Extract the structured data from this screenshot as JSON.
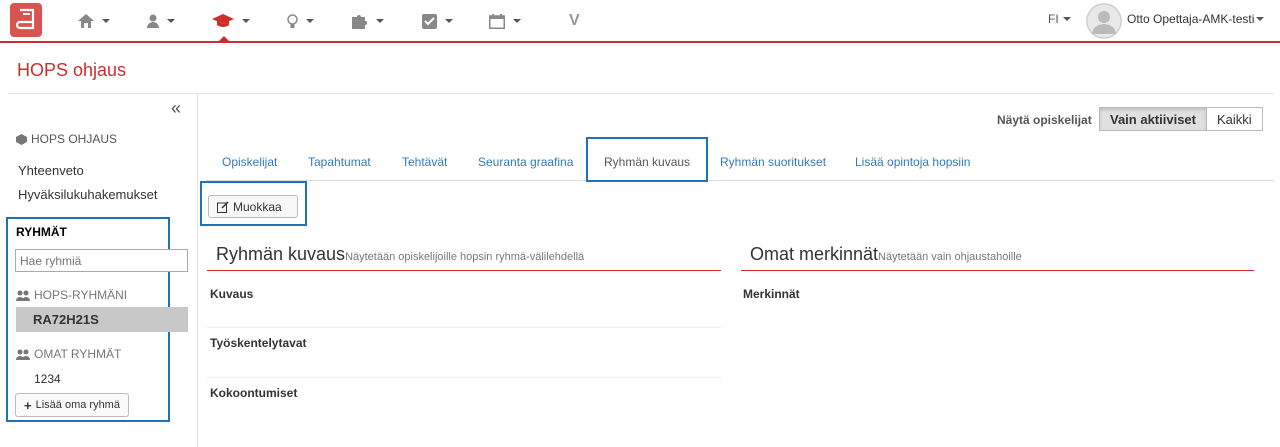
{
  "nav": {
    "items": [
      {
        "icon": "home-icon"
      },
      {
        "icon": "user-icon"
      },
      {
        "icon": "graduation-cap-icon",
        "active": true
      },
      {
        "icon": "lightbulb-icon"
      },
      {
        "icon": "puzzle-icon"
      },
      {
        "icon": "checkbox-icon"
      },
      {
        "icon": "calendar-icon"
      }
    ],
    "v_label": "V",
    "lang": "FI",
    "user_name": "Otto Opettaja-AMK-testi",
    "accent": "#c9302c"
  },
  "page": {
    "title": "HOPS ohjaus"
  },
  "sidebar": {
    "collapse_icon": "«",
    "heading": "HOPS OHJAUS",
    "links": [
      "Yhteenveto",
      "Hyväksilukuhakemukset"
    ],
    "groups": {
      "title": "RYHMÄT",
      "search_placeholder": "Hae ryhmiä",
      "hops_heading": "HOPS-RYHMÄNI",
      "hops_selected": "RA72H21S",
      "own_heading": "OMAT RYHMÄT",
      "own_item": "1234",
      "add_button": "Lisää oma ryhmä"
    }
  },
  "filter": {
    "label": "Näytä opiskelijat",
    "active_option": "Vain aktiiviset",
    "other_option": "Kaikki"
  },
  "tabs": {
    "items": [
      "Opiskelijat",
      "Tapahtumat",
      "Tehtävät",
      "Seuranta graafina",
      "Ryhmän kuvaus",
      "Ryhmän suoritukset",
      "Lisää opintoja hopsiin"
    ],
    "active": "Ryhmän kuvaus"
  },
  "edit_button": "Muokkaa",
  "description": {
    "title": "Ryhmän kuvaus",
    "subtitle": "Näytetään opiskelijoille hopsin ryhmä-välilehdellä",
    "fields": [
      "Kuvaus",
      "Työskentelytavat",
      "Kokoontumiset"
    ]
  },
  "notes": {
    "title": "Omat merkinnät",
    "subtitle": "Näytetään vain ohjaustahoille",
    "fields": [
      "Merkinnät"
    ]
  },
  "highlight_color": "#1f72b8"
}
